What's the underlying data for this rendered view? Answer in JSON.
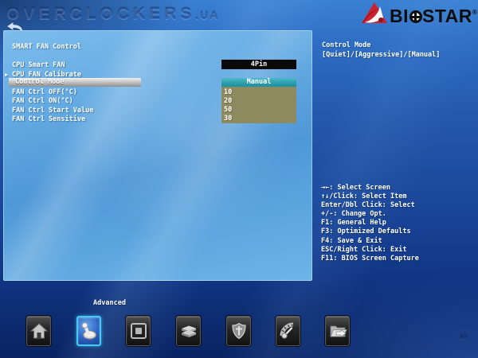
{
  "watermark": {
    "text": "OVERCLOCKERS",
    "suffix": ".UA"
  },
  "logo": {
    "pre": "BI",
    "post": "STAR",
    "reg": "®"
  },
  "panel": {
    "title": "SMART FAN Control"
  },
  "menu": {
    "items": [
      {
        "label": "CPU Smart FAN",
        "value": "4Pin"
      },
      {
        "label": "CPU FAN Calibrate",
        "bullet": "▶"
      },
      {
        "label": "Control Mode",
        "value": "Manual",
        "selected": true
      },
      {
        "label": "FAN Ctrl OFF(°C)",
        "value": "10"
      },
      {
        "label": "FAN Ctrl ON(°C)",
        "value": "20"
      },
      {
        "label": "FAN Ctrl Start Value",
        "value": "50"
      },
      {
        "label": "FAN Ctrl Sensitive",
        "value": "30"
      }
    ]
  },
  "help": {
    "title": "Control Mode",
    "options": "[Quiet]/[Aggressive]/[Manual]"
  },
  "key_hints": [
    "→←: Select Screen",
    "↑↓/Click: Select Item",
    "Enter/Dbl Click: Select",
    "+/-: Change Opt.",
    "F1: General Help",
    "F3: Optimized Defaults",
    "F4: Save & Exit",
    "ESC/Right Click: Exit",
    "F11: BIOS Screen Capture"
  ],
  "dock": {
    "active_label": "Advanced",
    "active_index": 1,
    "icons": [
      "home-icon",
      "advanced-toggle-icon",
      "chipset-icon",
      "storage-drives-icon",
      "security-shield-icon",
      "hw-monitor-gauge-icon",
      "save-exit-folder-icon"
    ]
  },
  "status": {
    "version_code": "AB"
  },
  "colors": {
    "logo_red": "#cf2030",
    "value_box_black": "#0a0a0a",
    "value_box_olive": "#8e8a60",
    "selected_teal": "#2d9fae",
    "selected_silver": "#c6c6c6",
    "dock_active_border": "#3ecdf6",
    "panel_blue": "#5aa4de"
  }
}
